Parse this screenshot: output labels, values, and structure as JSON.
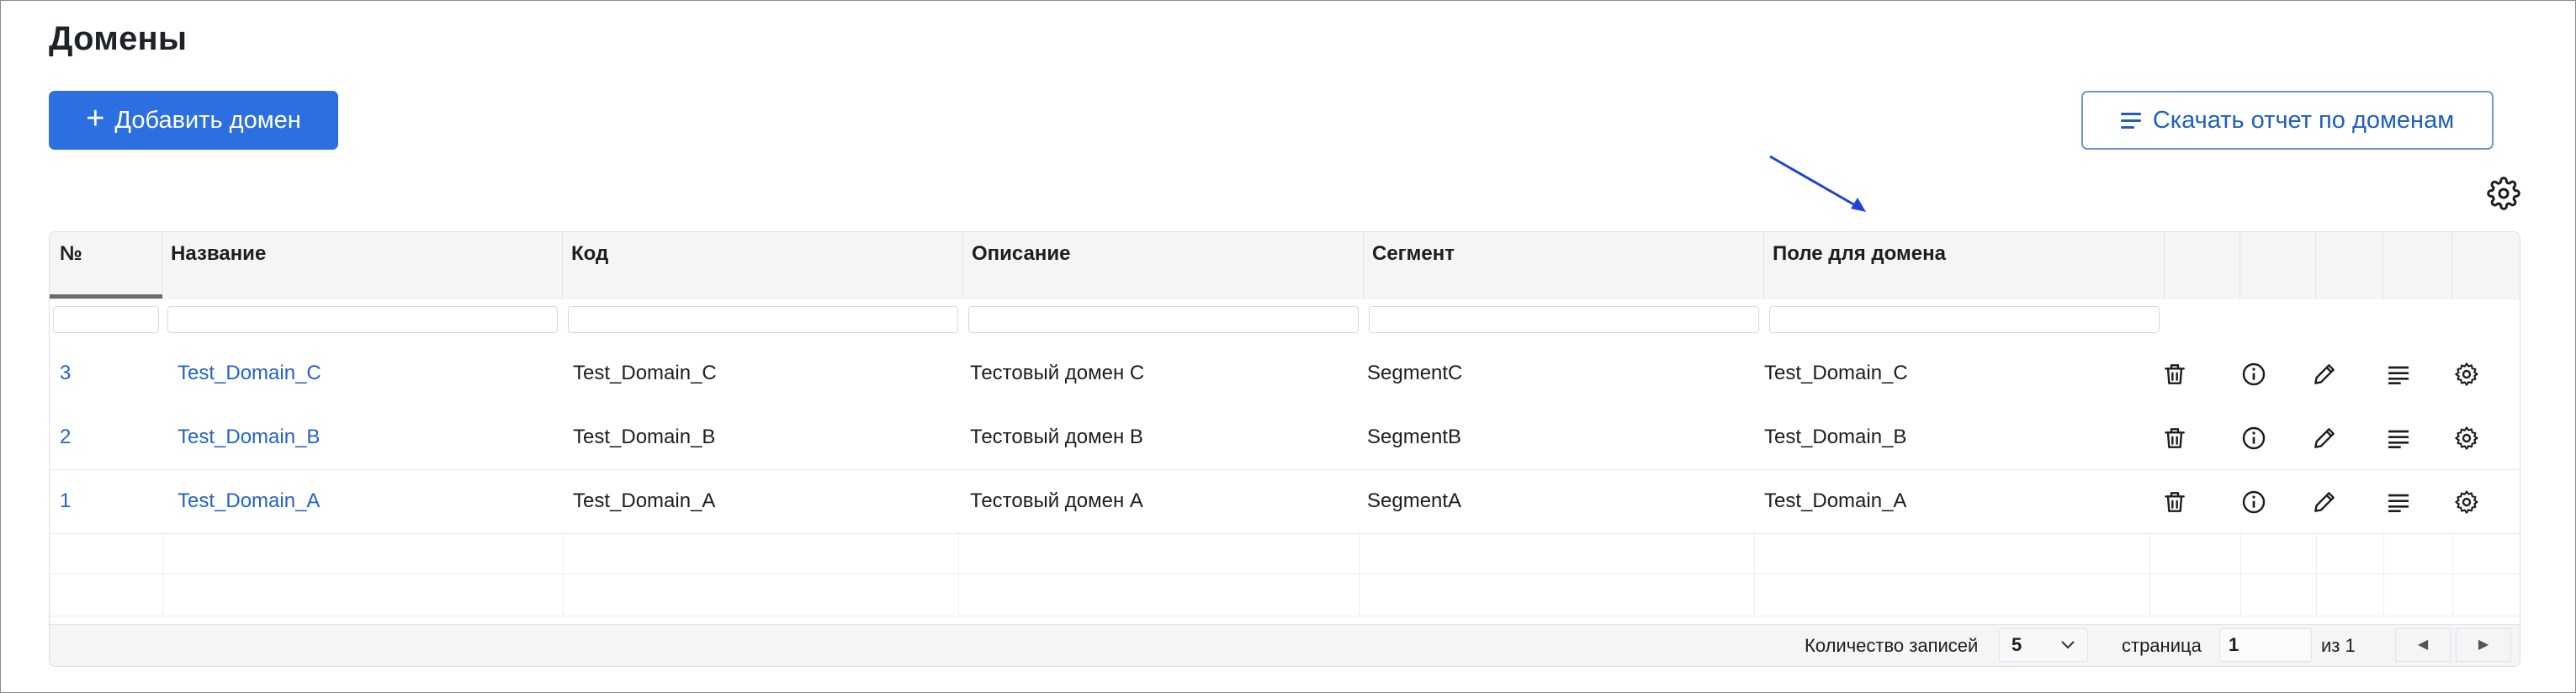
{
  "page": {
    "title": "Домены"
  },
  "toolbar": {
    "add_label": "Добавить домен",
    "report_label": "Скачать отчет по доменам"
  },
  "table": {
    "columns": [
      "№",
      "Название",
      "Код",
      "Описание",
      "Сегмент",
      "Поле для домена"
    ],
    "rows": [
      {
        "num": "3",
        "name": "Test_Domain_C",
        "code": "Test_Domain_C",
        "description": "Тестовый домен C",
        "segment": "SegmentC",
        "domain_field": "Test_Domain_C"
      },
      {
        "num": "2",
        "name": "Test_Domain_B",
        "code": "Test_Domain_B",
        "description": "Тестовый домен B",
        "segment": "SegmentB",
        "domain_field": "Test_Domain_B"
      },
      {
        "num": "1",
        "name": "Test_Domain_A",
        "code": "Test_Domain_A",
        "description": "Тестовый домен A",
        "segment": "SegmentA",
        "domain_field": "Test_Domain_A"
      }
    ],
    "row_actions": [
      "trash-icon",
      "info-icon",
      "pencil-icon",
      "list-icon",
      "gear-icon"
    ]
  },
  "footer": {
    "records_label": "Количество записей",
    "page_size": "5",
    "page_label": "страница",
    "page_value": "1",
    "of_label": "из 1",
    "prev_symbol": "◀",
    "next_symbol": "▶"
  },
  "colors": {
    "accent": "#2b6fe0",
    "link": "#2463c9",
    "annotation_arrow": "#1f44d6"
  }
}
